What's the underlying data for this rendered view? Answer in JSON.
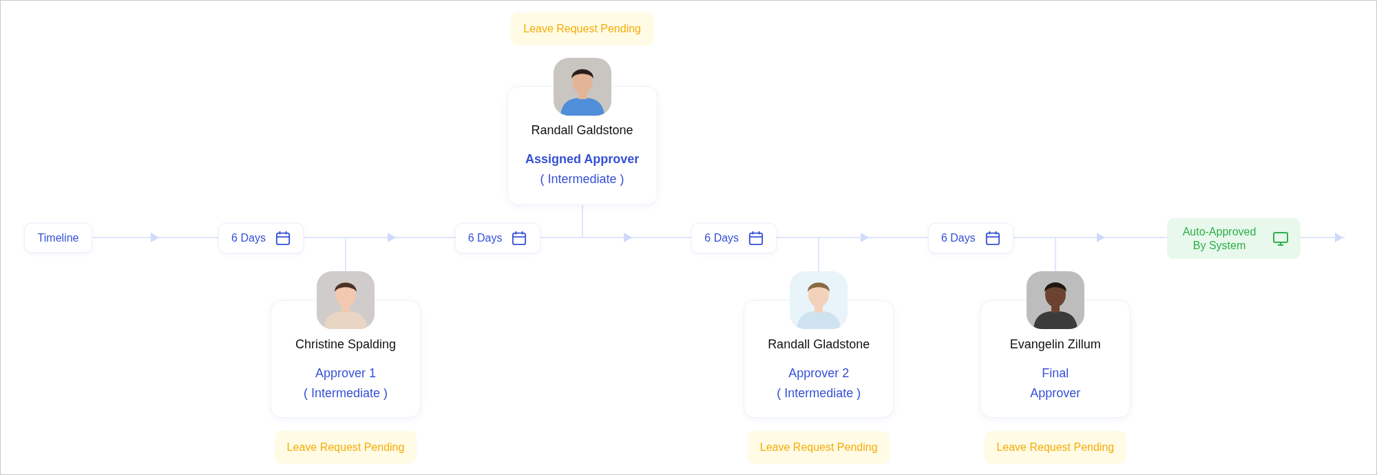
{
  "timeline": {
    "label": "Timeline"
  },
  "durations": [
    {
      "label": "6 Days"
    },
    {
      "label": "6 Days"
    },
    {
      "label": "6 Days"
    },
    {
      "label": "6 Days"
    }
  ],
  "approvers": [
    {
      "kind": "below",
      "name": "Christine Spalding",
      "role": "Approver 1",
      "level": "( Intermediate )",
      "primary": false,
      "status": "Leave Request Pending"
    },
    {
      "kind": "above",
      "name": "Randall Galdstone",
      "role": "Assigned Approver",
      "level": "( Intermediate )",
      "primary": true,
      "status": "Leave Request Pending"
    },
    {
      "kind": "below",
      "name": "Randall Gladstone",
      "role": "Approver 2",
      "level": "( Intermediate )",
      "primary": false,
      "status": "Leave Request Pending"
    },
    {
      "kind": "below",
      "name": "Evangelin Zillum",
      "role": "Final",
      "level": "Approver",
      "primary": false,
      "status": "Leave Request Pending"
    }
  ],
  "end": {
    "label": "Auto-Approved By System"
  }
}
